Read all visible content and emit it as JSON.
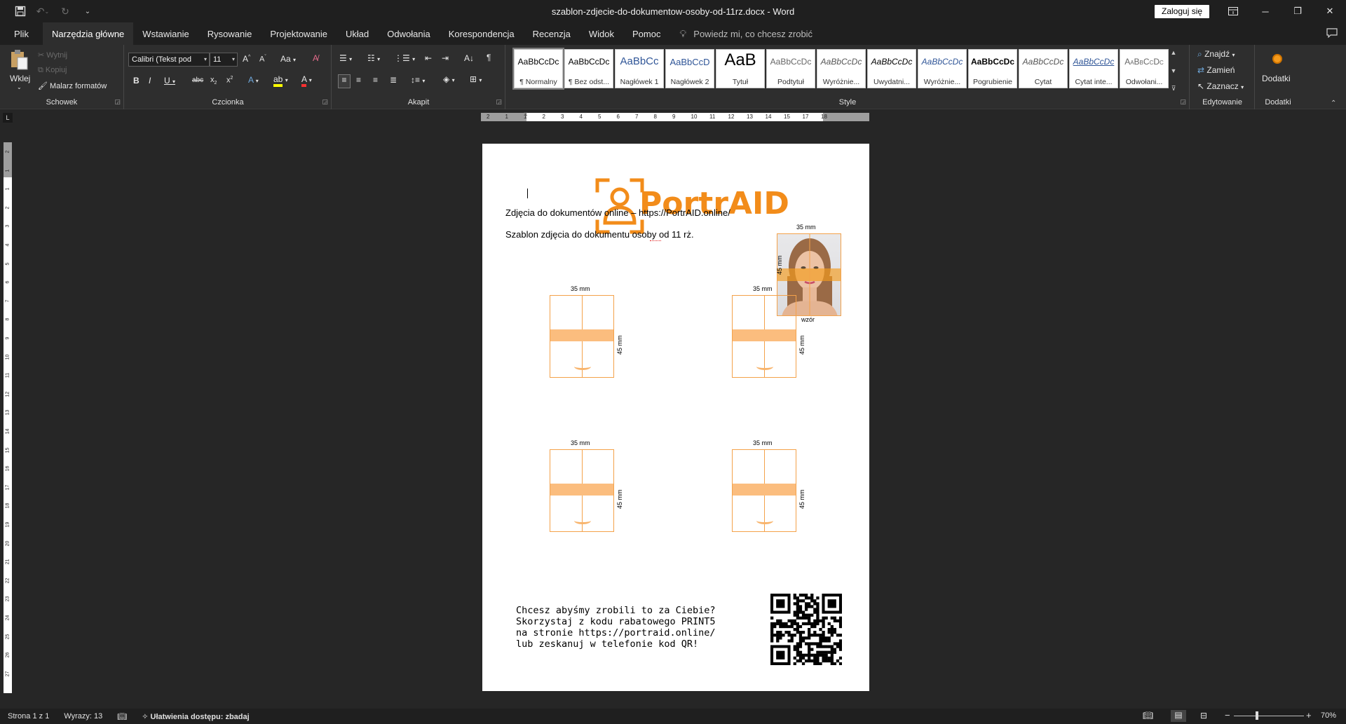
{
  "titlebar": {
    "doc_title": "szablon-zdjecie-do-dokumentow-osoby-od-11rz.docx  -  Word",
    "signin_label": "Zaloguj się"
  },
  "tabs": [
    {
      "label": "Plik"
    },
    {
      "label": "Narzędzia główne"
    },
    {
      "label": "Wstawianie"
    },
    {
      "label": "Rysowanie"
    },
    {
      "label": "Projektowanie"
    },
    {
      "label": "Układ"
    },
    {
      "label": "Odwołania"
    },
    {
      "label": "Korespondencja"
    },
    {
      "label": "Recenzja"
    },
    {
      "label": "Widok"
    },
    {
      "label": "Pomoc"
    }
  ],
  "tell_me": "Powiedz mi, co chcesz zrobić",
  "ribbon": {
    "clipboard": {
      "label": "Schowek",
      "paste": "Wklej",
      "cut": "Wytnij",
      "copy": "Kopiuj",
      "format_painter": "Malarz formatów"
    },
    "font": {
      "label": "Czcionka",
      "font_name": "Calibri (Tekst pod",
      "font_size": "11"
    },
    "paragraph": {
      "label": "Akapit"
    },
    "styles": {
      "label": "Style",
      "items": [
        {
          "preview": "AaBbCcDc",
          "name": "¶ Normalny"
        },
        {
          "preview": "AaBbCcDc",
          "name": "¶ Bez odst..."
        },
        {
          "preview": "AaBbCc",
          "name": "Nagłówek 1"
        },
        {
          "preview": "AaBbCcD",
          "name": "Nagłówek 2"
        },
        {
          "preview": "AaB",
          "name": "Tytuł"
        },
        {
          "preview": "AaBbCcDc",
          "name": "Podtytuł"
        },
        {
          "preview": "AaBbCcDc",
          "name": "Wyróżnie..."
        },
        {
          "preview": "AaBbCcDc",
          "name": "Uwydatni..."
        },
        {
          "preview": "AaBbCcDc",
          "name": "Wyróżnie..."
        },
        {
          "preview": "AaBbCcDc",
          "name": "Pogrubienie"
        },
        {
          "preview": "AaBbCcDc",
          "name": "Cytat"
        },
        {
          "preview": "AaBbCcDc",
          "name": "Cytat inte..."
        },
        {
          "preview": "AaBbCcDc",
          "name": "Odwołani..."
        }
      ]
    },
    "editing": {
      "label": "Edytowanie",
      "find": "Znajdź",
      "replace": "Zamień",
      "select": "Zaznacz"
    },
    "addins": {
      "label": "Dodatki",
      "button": "Dodatki"
    }
  },
  "ruler": {
    "h_numbers": [
      "2",
      "1",
      "1",
      "2",
      "3",
      "4",
      "5",
      "6",
      "7",
      "8",
      "9",
      "10",
      "11",
      "12",
      "13",
      "14",
      "15",
      "17",
      "18"
    ],
    "v_numbers": [
      "2",
      "1",
      "1",
      "2",
      "3",
      "4",
      "5",
      "6",
      "7",
      "8",
      "9",
      "10",
      "11",
      "12",
      "13",
      "14",
      "15",
      "16",
      "17",
      "18",
      "19",
      "20",
      "21",
      "22",
      "23",
      "24",
      "25",
      "26",
      "27"
    ]
  },
  "document": {
    "logo_text": "PortrAID",
    "line1": "Zdjęcia do dokumentów online – https://PortrAID.online/",
    "line2": "Szablon zdjęcia do dokumentu osoby od 11 rż.",
    "sample_width": "35 mm",
    "sample_height": "45 mm",
    "sample_caption": "wzór",
    "frames": [
      {
        "width_label": "35 mm",
        "height_label": "45 mm"
      },
      {
        "width_label": "35 mm",
        "height_label": "45 mm"
      },
      {
        "width_label": "35 mm",
        "height_label": "45 mm"
      },
      {
        "width_label": "35 mm",
        "height_label": "45 mm"
      }
    ],
    "promo_lines": [
      "Chcesz abyśmy zrobili to za Ciebie?",
      "Skorzystaj z kodu rabatowego PRINT5",
      "na stronie https://portraid.online/",
      "lub zeskanuj w telefonie kod QR!"
    ]
  },
  "statusbar": {
    "page": "Strona 1 z 1",
    "words": "Wyrazy: 13",
    "accessibility": "Ułatwienia dostępu: zbadaj",
    "zoom": "70%"
  },
  "colors": {
    "accent_orange": "#f28c1a",
    "frame_orange": "#f4a24a",
    "band_orange": "#fbbd7e",
    "titlebar_bg": "#1f1f1f",
    "ribbon_bg": "#2e2e2e",
    "canvas_bg": "#262626"
  }
}
